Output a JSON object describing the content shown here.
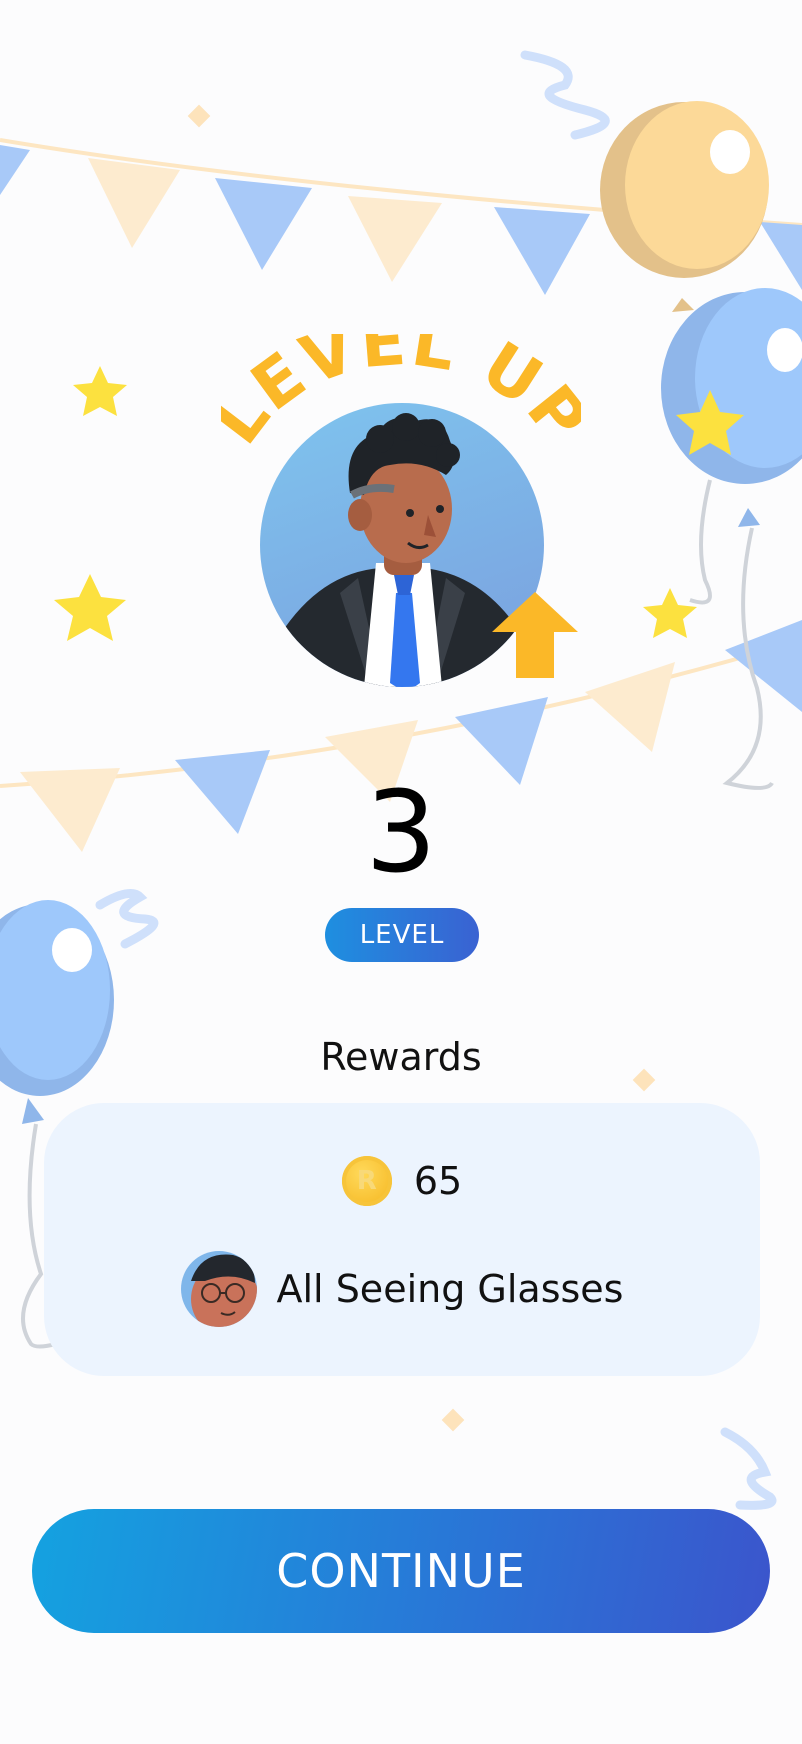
{
  "header": {
    "title": "LEVEL UP"
  },
  "level": {
    "number": "3",
    "badge_label": "LEVEL"
  },
  "rewards": {
    "heading": "Rewards",
    "coin": {
      "symbol": "R",
      "amount": "65"
    },
    "item": {
      "name": "All Seeing Glasses"
    }
  },
  "actions": {
    "continue_label": "CONTINUE"
  },
  "colors": {
    "accent_blue": "#2a74d6",
    "title_yellow": "#fbb828",
    "card_background": "#ecf4fe",
    "balloon_blue": "#9ec8fb",
    "balloon_yellow": "#fcd998"
  },
  "icons": [
    "balloon-icon",
    "star-icon",
    "pennant-banner",
    "up-arrow-icon",
    "coin-icon",
    "avatar"
  ]
}
